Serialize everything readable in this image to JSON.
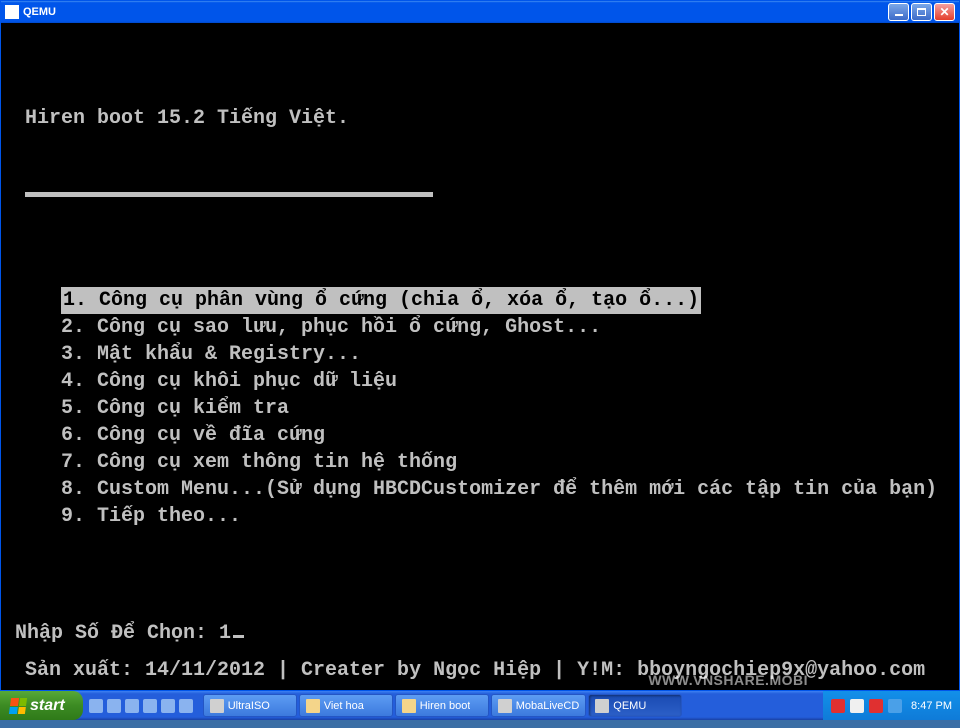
{
  "window": {
    "title": "QEMU"
  },
  "console": {
    "title": "Hiren boot 15.2 Tiếng Việt.",
    "menu": [
      {
        "text": "1. Công cụ phân vùng ổ cứng (chia ổ, xóa ổ, tạo ổ...)",
        "selected": true
      },
      {
        "text": "2. Công cụ sao lưu, phục hồi ổ cứng, Ghost...",
        "selected": false
      },
      {
        "text": "3. Mật khẩu & Registry...",
        "selected": false
      },
      {
        "text": "4. Công cụ khôi phục dữ liệu",
        "selected": false
      },
      {
        "text": "5. Công cụ kiểm tra",
        "selected": false
      },
      {
        "text": "6. Công cụ về đĩa cứng",
        "selected": false
      },
      {
        "text": "7. Công cụ xem thông tin hệ thống",
        "selected": false
      },
      {
        "text": "8. Custom Menu...(Sử dụng HBCDCustomizer để thêm mới các tập tin của bạn)",
        "selected": false
      },
      {
        "text": "9. Tiếp theo...",
        "selected": false
      }
    ],
    "prompt_label": "Nhập Số Để Chọn: ",
    "prompt_value": "1",
    "footer": "Sản xuất: 14/11/2012 | Creater by Ngọc Hiệp | Y!M: bboyngochiep9x@yahoo.com"
  },
  "taskbar": {
    "start": "start",
    "tasks": [
      {
        "label": "UltraISO",
        "icon": "app",
        "active": false
      },
      {
        "label": "Viet hoa",
        "icon": "folder",
        "active": false
      },
      {
        "label": "Hiren boot",
        "icon": "folder",
        "active": false
      },
      {
        "label": "MobaLiveCD",
        "icon": "app",
        "active": false
      },
      {
        "label": "QEMU",
        "icon": "app",
        "active": true
      }
    ],
    "clock": "8:47 PM"
  },
  "watermark": "WWW.VNSHARE.MOBI"
}
